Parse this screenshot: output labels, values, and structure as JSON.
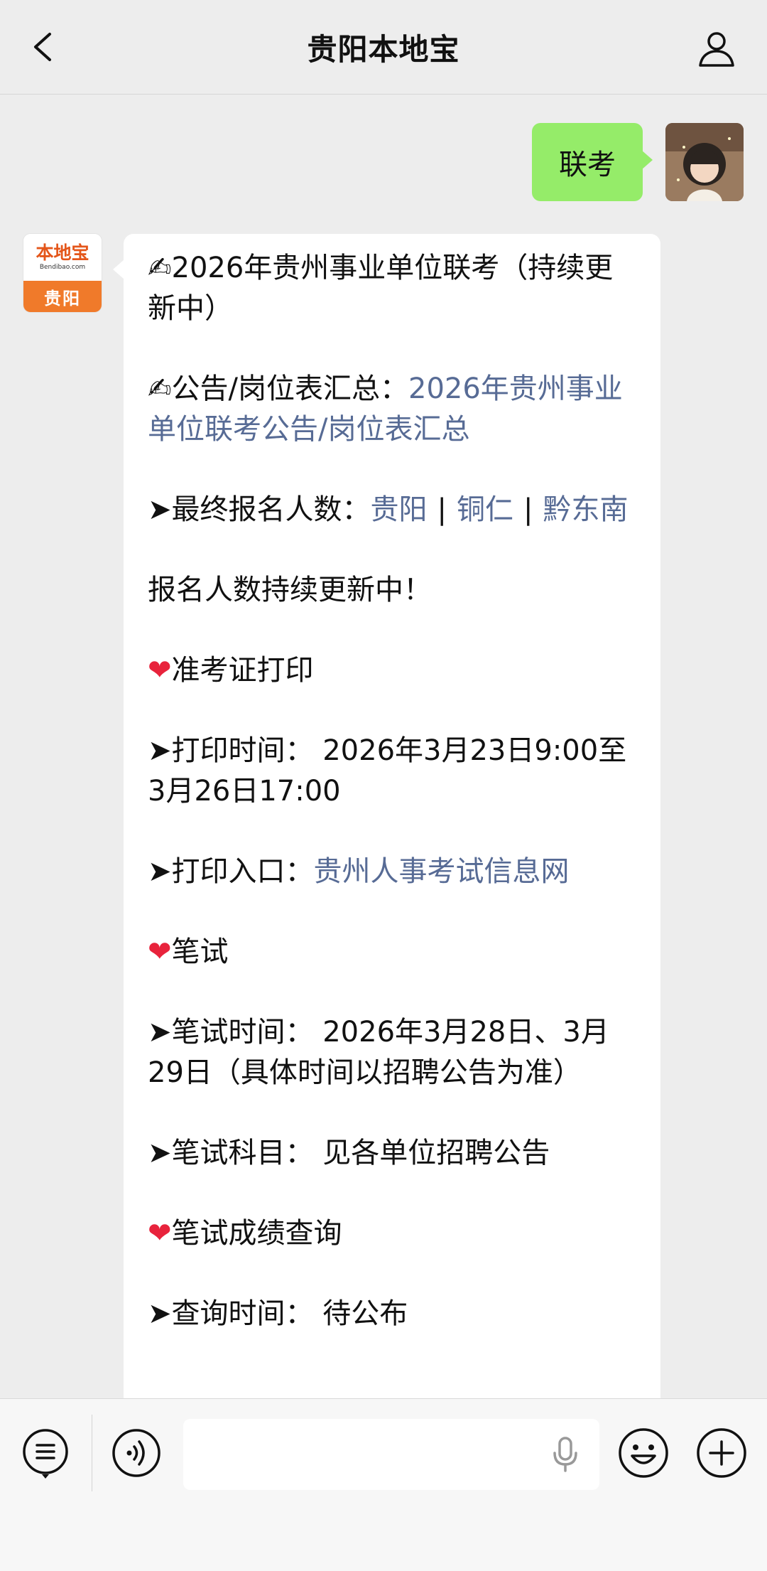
{
  "header": {
    "title": "贵阳本地宝"
  },
  "user_message": {
    "text": "联考"
  },
  "bot_avatar": {
    "logo_text": "本地宝",
    "logo_sub": "Bendibao.com",
    "city": "贵阳"
  },
  "bot_message": {
    "p1": "2026年贵州事业单位联考（持续更新中）",
    "p2_prefix": "公告/岗位表汇总：",
    "p2_link": "2026年贵州事业单位联考公告/岗位表汇总",
    "p3_prefix": "➤最终报名人数：",
    "p3_links": [
      "贵阳",
      "铜仁",
      "黔东南"
    ],
    "p3_sep": "|",
    "p4": "报名人数持续更新中！",
    "h1": "准考证打印",
    "p5": "➤打印时间： 2026年3月23日9:00至3月26日17:00",
    "p6_prefix": "➤打印入口：",
    "p6_link": "贵州人事考试信息网",
    "h2": "笔试",
    "p7": "➤笔试时间： 2026年3月28日、3月29日（具体时间以招聘公告为准）",
    "p8": "➤笔试科目： 见各单位招聘公告",
    "h3": "笔试成绩查询",
    "p9": "➤查询时间： 待公布"
  },
  "icons": {
    "back": "chevron-left-icon",
    "profile": "person-icon",
    "menu": "list-menu-icon",
    "voice": "voice-wave-icon",
    "mic": "microphone-icon",
    "emoji": "smiley-icon",
    "plus": "plus-icon"
  },
  "colors": {
    "background": "#ededed",
    "user_bubble": "#95ec69",
    "link": "#576b95",
    "brand_orange": "#f07a2a",
    "heart": "#e8233c"
  }
}
